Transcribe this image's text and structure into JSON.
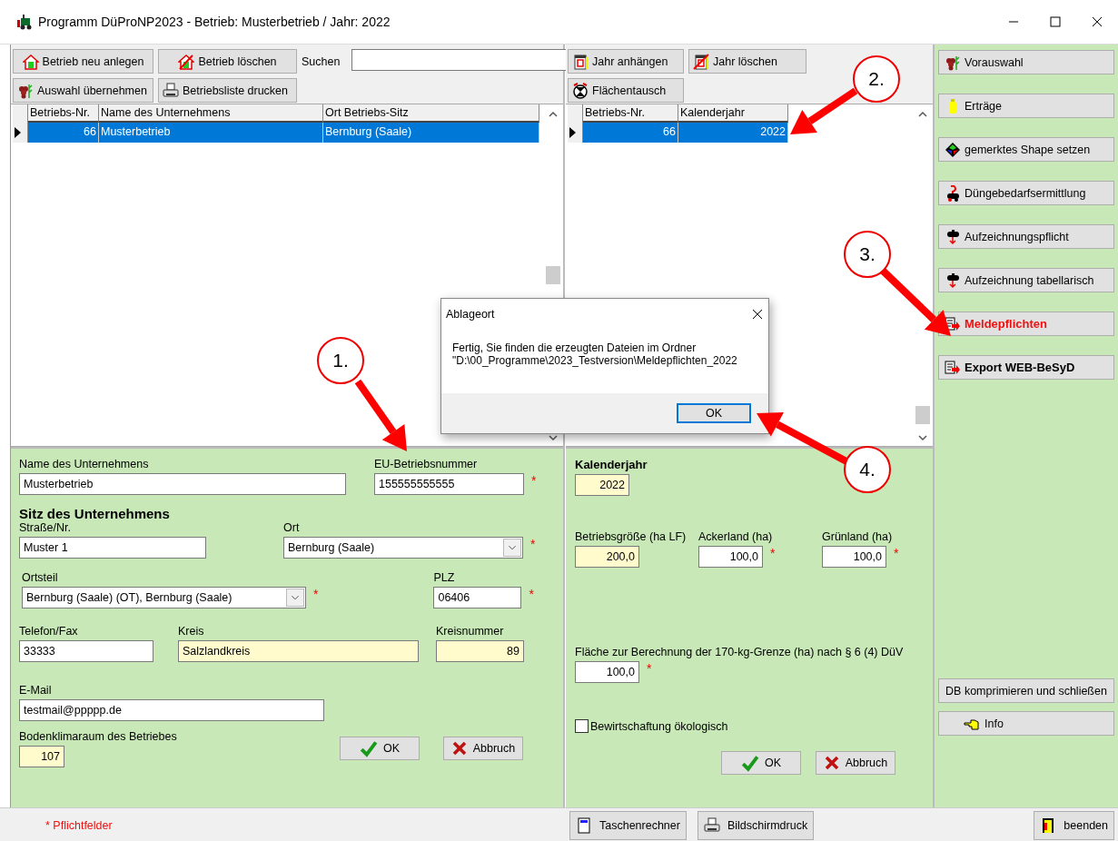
{
  "window": {
    "title": "Programm DüProNP2023 - Betrieb: Musterbetrieb / Jahr: 2022"
  },
  "company_panel": {
    "toolbar": [
      {
        "label": "Betrieb neu anlegen"
      },
      {
        "label": "Betrieb löschen"
      },
      {
        "label": "Auswahl übernehmen"
      },
      {
        "label": "Betriebsliste drucken"
      }
    ],
    "search": {
      "label": "Suchen"
    },
    "table": {
      "columns": [
        "Betriebs-Nr.",
        "Name des Unternehmens",
        "Ort Betriebs-Sitz"
      ],
      "rows": [
        {
          "cells": [
            "66",
            "Musterbetrieb",
            "Bernburg (Saale)"
          ],
          "selected": true
        }
      ]
    }
  },
  "company_form": {
    "name": {
      "label": "Name des Unternehmens",
      "value": "Musterbetrieb",
      "readonly": false
    },
    "eu_number": {
      "label": "EU-Betriebsnummer",
      "value": "155555555555",
      "readonly": false,
      "required_mark": "*"
    },
    "section_heading": "Sitz des Unternehmens",
    "street": {
      "label": "Straße/Nr.",
      "value": "Muster 1",
      "readonly": false
    },
    "city": {
      "label": "Ort",
      "value": "Bernburg (Saale)",
      "readonly": false,
      "required_mark": "*"
    },
    "district": {
      "label": "Ortsteil",
      "value": "Bernburg (Saale) (OT), Bernburg (Saale)",
      "readonly": false,
      "required_mark": "*"
    },
    "zip": {
      "label": "PLZ",
      "value": "06406",
      "readonly": false,
      "required_mark": "*"
    },
    "phone": {
      "label": "Telefon/Fax",
      "value": "33333",
      "readonly": false
    },
    "county": {
      "label": "Kreis",
      "value": "Salzlandkreis",
      "readonly": true
    },
    "county_number": {
      "label": "Kreisnummer",
      "value": "89",
      "readonly": true
    },
    "email": {
      "label": "E-Mail",
      "value": "testmail@ppppp.de",
      "readonly": false
    },
    "soil_climate_area": {
      "label": "Bodenklimaraum des Betriebes",
      "value": "107",
      "readonly": true
    },
    "buttons": [
      {
        "label": "OK"
      },
      {
        "label": "Abbruch"
      }
    ]
  },
  "year_panel": {
    "toolbar": [
      {
        "label": "Jahr anhängen"
      },
      {
        "label": "Jahr löschen"
      },
      {
        "label": "Flächentausch"
      }
    ],
    "table": {
      "columns": [
        "Betriebs-Nr.",
        "Kalenderjahr"
      ],
      "rows": [
        {
          "cells": [
            "66",
            "2022"
          ],
          "selected": true
        }
      ]
    }
  },
  "year_form": {
    "year": {
      "label": "Kalenderjahr",
      "value": "2022",
      "readonly": true
    },
    "farm_size": {
      "label": "Betriebsgröße (ha LF)",
      "value": "200,0",
      "readonly": true
    },
    "arable": {
      "label": "Ackerland (ha)",
      "value": "100,0",
      "readonly": false,
      "required_mark": "*"
    },
    "grassland": {
      "label": "Grünland (ha)",
      "value": "100,0",
      "readonly": false,
      "required_mark": "*"
    },
    "area_170kg": {
      "label": "Fläche zur Berechnung der 170-kg-Grenze (ha) nach § 6 (4) DüV",
      "value": "100,0",
      "readonly": false,
      "required_mark": "*"
    },
    "organic": {
      "label": "Bewirtschaftung ökologisch",
      "checked": false
    },
    "buttons": [
      {
        "label": "OK"
      },
      {
        "label": "Abbruch"
      }
    ]
  },
  "sidebar": {
    "buttons": [
      {
        "label": "Vorauswahl",
        "kind": "normal"
      },
      {
        "label": "Erträge",
        "kind": "normal"
      },
      {
        "label": "gemerktes Shape setzen",
        "kind": "normal"
      },
      {
        "label": "Düngebedarfsermittlung",
        "kind": "normal"
      },
      {
        "label": "Aufzeichnungspflicht",
        "kind": "normal"
      },
      {
        "label": "Aufzeichnung tabellarisch",
        "kind": "normal"
      },
      {
        "label": "Meldepflichten",
        "kind": "alert"
      },
      {
        "label": "Export WEB-BeSyD",
        "kind": "bold"
      }
    ],
    "bottom_buttons": [
      {
        "label": "DB komprimieren und schließen"
      },
      {
        "label": "Info"
      }
    ]
  },
  "status_bar": {
    "note": "* Pflichtfelder",
    "buttons": [
      {
        "label": "Taschenrechner"
      },
      {
        "label": "Bildschirmdruck"
      }
    ],
    "exit_button": {
      "label": "beenden"
    }
  },
  "dialog": {
    "title": "Ablageort",
    "message": [
      "Fertig, Sie finden die erzeugten Dateien im Ordner",
      "\"D:\\00_Programme\\2023_Testversion\\Meldepflichten_2022"
    ],
    "button": "OK"
  },
  "callouts": [
    {
      "label": "1."
    },
    {
      "label": "2."
    },
    {
      "label": "3."
    },
    {
      "label": "4."
    }
  ]
}
